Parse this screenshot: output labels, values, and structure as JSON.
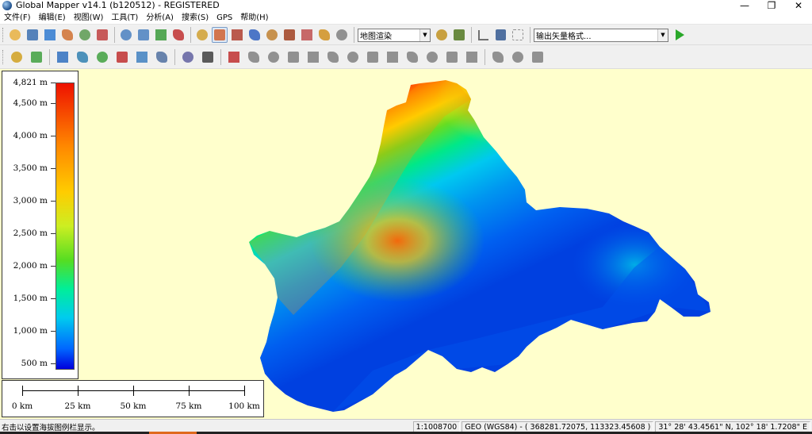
{
  "window": {
    "title": "Global Mapper v14.1 (b120512) - REGISTERED",
    "minimize": "—",
    "restore": "❐",
    "close": "✕"
  },
  "menu": [
    "文件(F)",
    "编辑(E)",
    "视图(W)",
    "工具(T)",
    "分析(A)",
    "搜索(S)",
    "GPS",
    "帮助(H)"
  ],
  "toolbar": {
    "render_mode": "地图渲染",
    "export_format": "输出矢量格式...",
    "buttons_row1": [
      {
        "name": "open-icon",
        "color": "#e8b040"
      },
      {
        "name": "save-icon",
        "color": "#3a6fb0"
      },
      {
        "name": "globe-icon",
        "color": "#2f7ad0"
      },
      {
        "name": "control-center-icon",
        "color": "#d07030"
      },
      {
        "name": "overlay-icon",
        "color": "#5a9a50"
      },
      {
        "name": "config-icon",
        "color": "#c04040"
      },
      {
        "name": "zoom-in-icon",
        "color": "#4a80c0"
      },
      {
        "name": "zoom-out-icon",
        "color": "#4a80c0"
      },
      {
        "name": "zoom-full-icon",
        "color": "#3a9a3a"
      },
      {
        "name": "home-icon",
        "color": "#c03030"
      },
      {
        "name": "select-icon",
        "color": "#d0a030"
      },
      {
        "name": "pan-icon",
        "color": "#d06030"
      },
      {
        "name": "measure-icon",
        "color": "#b04030"
      },
      {
        "name": "info-icon",
        "color": "#3060c0"
      },
      {
        "name": "path-profile-icon",
        "color": "#c08030"
      },
      {
        "name": "view-shed-icon",
        "color": "#a04020"
      },
      {
        "name": "digitizer-icon",
        "color": "#c05050"
      },
      {
        "name": "feature-info-icon",
        "color": "#d09020"
      },
      {
        "name": "hand-icon",
        "color": "#808080"
      }
    ],
    "buttons_row2": [
      {
        "name": "create-area-icon",
        "color": "#d0a020"
      },
      {
        "name": "create-line-icon",
        "color": "#40a040"
      },
      {
        "name": "create-point-icon",
        "color": "#3070c0"
      },
      {
        "name": "edit-vertices-icon",
        "color": "#3080b0"
      },
      {
        "name": "split-icon",
        "color": "#40a040"
      },
      {
        "name": "cad-icon",
        "color": "#c03030"
      },
      {
        "name": "rotate-icon",
        "color": "#4080c0"
      },
      {
        "name": "grid-icon",
        "color": "#5070a0"
      },
      {
        "name": "vertex-add-icon",
        "color": "#6060a0"
      },
      {
        "name": "vertex-move-icon",
        "color": "#404040"
      },
      {
        "name": "draw-icon",
        "color": "#c03030"
      },
      {
        "name": "shape-1-icon",
        "color": "#808080"
      },
      {
        "name": "shape-2-icon",
        "color": "#808080"
      },
      {
        "name": "shape-3-icon",
        "color": "#808080"
      },
      {
        "name": "shape-4-icon",
        "color": "#808080"
      },
      {
        "name": "shape-5-icon",
        "color": "#808080"
      },
      {
        "name": "shape-6-icon",
        "color": "#808080"
      },
      {
        "name": "shape-7-icon",
        "color": "#808080"
      },
      {
        "name": "shape-8-icon",
        "color": "#808080"
      },
      {
        "name": "shape-9-icon",
        "color": "#808080"
      },
      {
        "name": "shape-10-icon",
        "color": "#808080"
      },
      {
        "name": "shape-11-icon",
        "color": "#808080"
      },
      {
        "name": "shape-12-icon",
        "color": "#808080"
      },
      {
        "name": "shape-13-icon",
        "color": "#808080"
      },
      {
        "name": "shape-14-icon",
        "color": "#808080"
      },
      {
        "name": "shape-15-icon",
        "color": "#808080"
      }
    ]
  },
  "legend": {
    "labels": [
      "4,821 m",
      "4,500 m",
      "4,000 m",
      "3,500 m",
      "3,000 m",
      "2,500 m",
      "2,000 m",
      "1,500 m",
      "1,000 m",
      "500 m"
    ],
    "values": [
      4821,
      4500,
      4000,
      3500,
      3000,
      2500,
      2000,
      1500,
      1000,
      500
    ],
    "min": 400,
    "max": 4821
  },
  "scale": {
    "labels": [
      "0 km",
      "25 km",
      "50 km",
      "75 km",
      "100 km"
    ]
  },
  "status": {
    "hint": "右击以设置海拔图例栏显示。",
    "scale_ratio": "1:1008700",
    "projection": "GEO (WGS84) - ( 368281.72075, 113323.45608 )",
    "latlon": "31° 28' 43.4561\" N, 102° 18' 1.7208\" E"
  },
  "map_colors": {
    "background": "#ffffcc"
  }
}
